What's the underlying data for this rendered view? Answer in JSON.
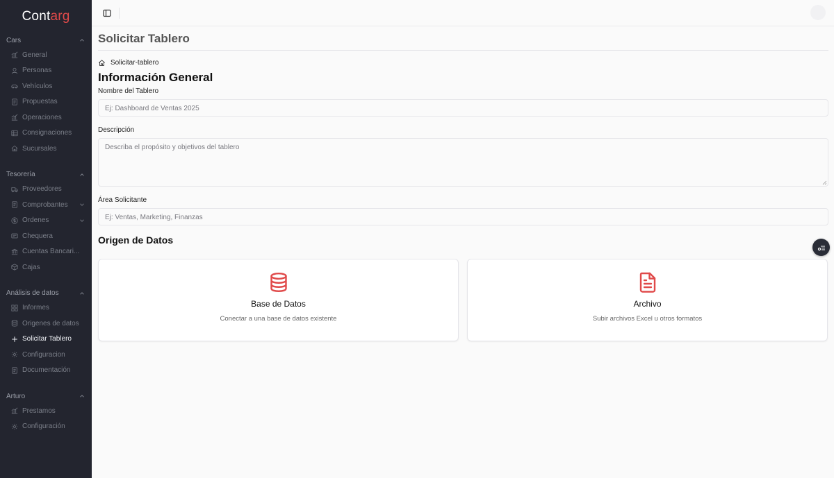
{
  "brand": {
    "name_part1": "Cont",
    "name_part2": "arg",
    "accent_color": "#e04a4a"
  },
  "sidebar": {
    "sections": [
      {
        "title": "Cars",
        "items": [
          {
            "label": "General",
            "icon": "chart-icon"
          },
          {
            "label": "Personas",
            "icon": "user-icon"
          },
          {
            "label": "Vehículos",
            "icon": "car-icon"
          },
          {
            "label": "Propuestas",
            "icon": "file-icon"
          },
          {
            "label": "Operaciones",
            "icon": "chart-icon"
          },
          {
            "label": "Consignaciones",
            "icon": "table-icon"
          },
          {
            "label": "Sucursales",
            "icon": "home-icon"
          }
        ]
      },
      {
        "title": "Tesorería",
        "items": [
          {
            "label": "Proveedores",
            "icon": "truck-icon"
          },
          {
            "label": "Comprobantes",
            "icon": "file-icon"
          },
          {
            "label": "Ordenes",
            "icon": "dollar-icon"
          },
          {
            "label": "Chequera",
            "icon": "card-icon"
          },
          {
            "label": "Cuentas Bancari...",
            "icon": "bank-icon"
          },
          {
            "label": "Cajas",
            "icon": "box-icon"
          }
        ]
      },
      {
        "title": "Análisis de datos",
        "items": [
          {
            "label": "Informes",
            "icon": "grid-icon"
          },
          {
            "label": "Origenes de datos",
            "icon": "database-icon"
          },
          {
            "label": "Solicitar Tablero",
            "icon": "plus-icon"
          },
          {
            "label": "Configuracion",
            "icon": "gear-icon"
          },
          {
            "label": "Documentación",
            "icon": "file-icon"
          }
        ]
      },
      {
        "title": "Arturo",
        "items": [
          {
            "label": "Prestamos",
            "icon": "chart-icon"
          },
          {
            "label": "Configuración",
            "icon": "gear-icon"
          }
        ]
      }
    ]
  },
  "page": {
    "title": "Solicitar Tablero",
    "breadcrumb": "Solicitar-tablero",
    "section_general": "Información General",
    "fields": {
      "nombre_label": "Nombre del Tablero",
      "nombre_placeholder": "Ej: Dashboard de Ventas 2025",
      "descripcion_label": "Descripción",
      "descripcion_placeholder": "Describa el propósito y objetivos del tablero",
      "area_label": "Área Solicitante",
      "area_placeholder": "Ej: Ventas, Marketing, Finanzas"
    },
    "section_origen": "Origen de Datos",
    "cards": {
      "db_title": "Base de Datos",
      "db_desc": "Conectar a una base de datos existente",
      "file_title": "Archivo",
      "file_desc": "Subir archivos Excel u otros formatos"
    }
  }
}
